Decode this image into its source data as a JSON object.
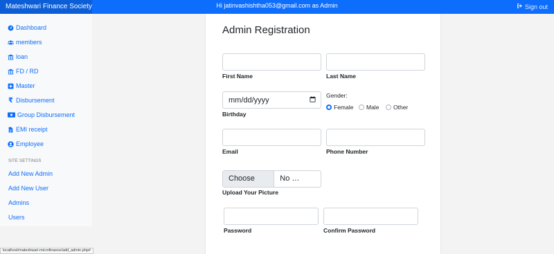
{
  "header": {
    "brand": "Mateshwari Finance Society",
    "welcome": "Hi jatinvashishtha053@gmail.com as Admin",
    "signout": "Sign out"
  },
  "sidebar": {
    "items": [
      {
        "label": "Dashboard",
        "icon": "tachometer-icon"
      },
      {
        "label": "members",
        "icon": "users-icon"
      },
      {
        "label": "loan",
        "icon": "bank-icon"
      },
      {
        "label": "FD / RD",
        "icon": "bank-icon"
      },
      {
        "label": "Master",
        "icon": "plus-square-icon"
      },
      {
        "label": "Disbursement",
        "icon": "rupee-icon"
      },
      {
        "label": "Group Disbursement",
        "icon": "money-bill-icon"
      },
      {
        "label": "EMI receipt",
        "icon": "file-icon"
      },
      {
        "label": "Employee",
        "icon": "user-circle-icon"
      }
    ],
    "site_settings_heading": "SITE SETTINGS",
    "settings_links": [
      "Add New Admin",
      "Add New User",
      "Admins",
      "Users"
    ]
  },
  "form": {
    "title": "Admin Registration",
    "first_name_label": "First Name",
    "last_name_label": "Last Name",
    "birthday_label": "Birthday",
    "birthday_placeholder": "mm/dd/yyyy",
    "gender_label": "Gender:",
    "gender_options": [
      "Female",
      "Male",
      "Other"
    ],
    "gender_selected": "Female",
    "email_label": "Email",
    "phone_label": "Phone Number",
    "file_button": "Choose File",
    "file_name": "No …osen",
    "picture_label": "Upload Your Picture",
    "password_label": "Password",
    "confirm_password_label": "Confirm Password"
  },
  "status_bar": {
    "url": "localhost/mateshwari-microfinance/add_admin.php#"
  },
  "colors": {
    "primary": "#0d6efd",
    "sidebar_bg": "#f8f9fa"
  }
}
